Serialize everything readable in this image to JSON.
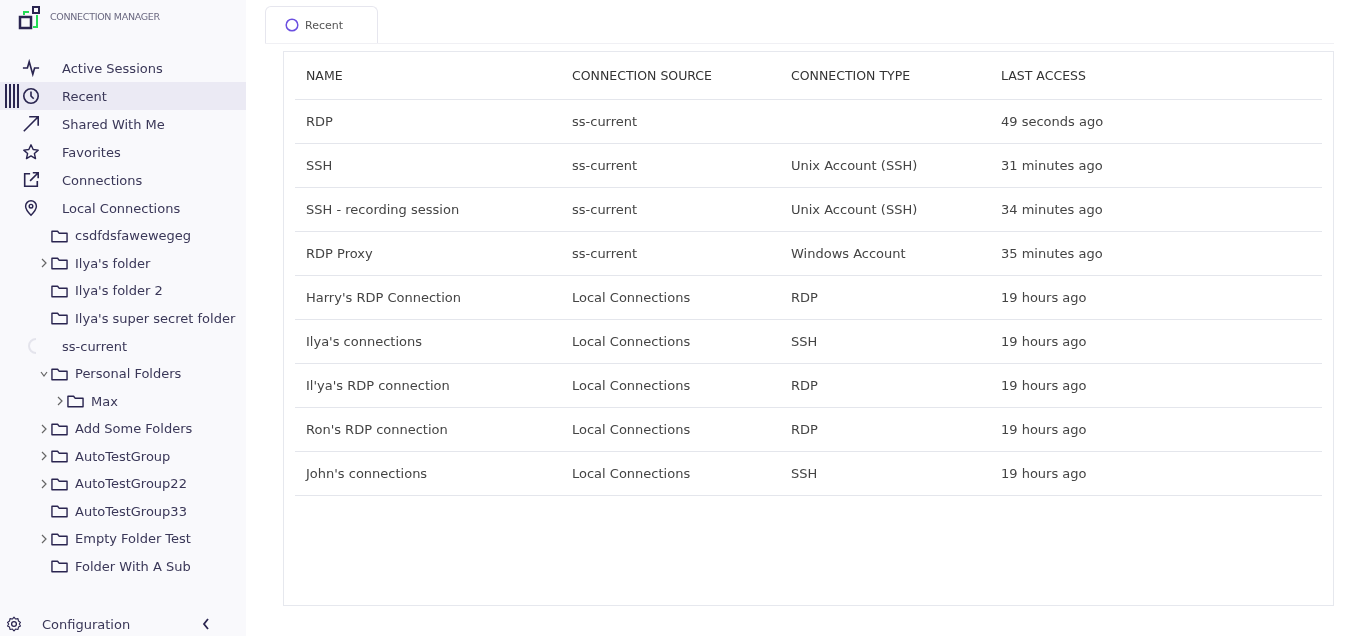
{
  "app": {
    "title": "CONNECTION MANAGER"
  },
  "sidebar": {
    "items": [
      {
        "label": "Active Sessions",
        "kind": "pulse",
        "selected": false
      },
      {
        "label": "Recent",
        "kind": "clock",
        "selected": true
      },
      {
        "label": "Shared With Me",
        "kind": "arrow",
        "selected": false
      },
      {
        "label": "Favorites",
        "kind": "star",
        "selected": false
      },
      {
        "label": "Connections",
        "kind": "external",
        "selected": false
      },
      {
        "label": "Local Connections",
        "kind": "pin",
        "selected": false,
        "children": [
          {
            "label": "csdfdsfawewegeg"
          },
          {
            "label": "Ilya's folder",
            "expanded": false
          },
          {
            "label": "Ilya's folder 2"
          },
          {
            "label": "Ilya's super secret folder"
          }
        ]
      },
      {
        "label": "ss-current",
        "kind": "source",
        "selected": false,
        "children": [
          {
            "label": "Personal Folders",
            "expanded": true,
            "children": [
              {
                "label": "Max",
                "expanded": false
              }
            ]
          },
          {
            "label": "Add Some Folders",
            "expanded": false
          },
          {
            "label": "AutoTestGroup",
            "expanded": false
          },
          {
            "label": "AutoTestGroup22",
            "expanded": false
          },
          {
            "label": "AutoTestGroup33"
          },
          {
            "label": "Empty Folder Test",
            "expanded": false
          },
          {
            "label": "Folder With A Sub"
          }
        ]
      }
    ],
    "footer": {
      "label": "Configuration"
    }
  },
  "tabs": [
    {
      "label": "Recent",
      "selected": true
    }
  ],
  "table": {
    "columns": [
      "NAME",
      "CONNECTION SOURCE",
      "CONNECTION TYPE",
      "LAST ACCESS"
    ],
    "rows": [
      [
        "RDP",
        "ss-current",
        "",
        "49 seconds ago"
      ],
      [
        "SSH",
        "ss-current",
        "Unix Account (SSH)",
        "31 minutes ago"
      ],
      [
        "SSH - recording session",
        "ss-current",
        "Unix Account (SSH)",
        "34 minutes ago"
      ],
      [
        "RDP Proxy",
        "ss-current",
        "Windows Account",
        "35 minutes ago"
      ],
      [
        "Harry's RDP Connection",
        "Local Connections",
        "RDP",
        "19 hours ago"
      ],
      [
        "Ilya's connections",
        "Local Connections",
        "SSH",
        "19 hours ago"
      ],
      [
        "Il'ya's RDP connection",
        "Local Connections",
        "RDP",
        "19 hours ago"
      ],
      [
        "Ron's RDP connection",
        "Local Connections",
        "RDP",
        "19 hours ago"
      ],
      [
        "John's connections",
        "Local Connections",
        "SSH",
        "19 hours ago"
      ]
    ]
  }
}
